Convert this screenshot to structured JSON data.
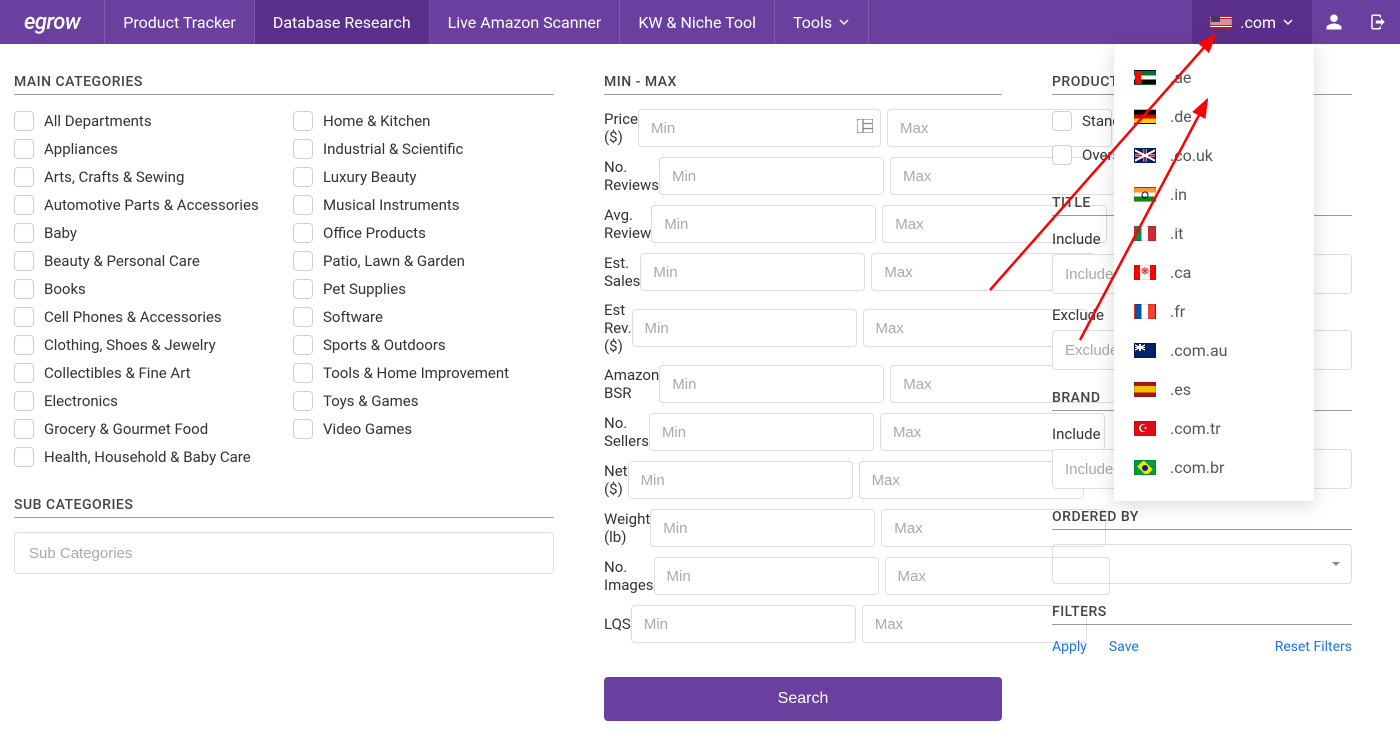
{
  "logo": "egrow",
  "nav": {
    "items": [
      {
        "label": "Product Tracker",
        "active": false
      },
      {
        "label": "Database Research",
        "active": true
      },
      {
        "label": "Live Amazon Scanner",
        "active": false
      },
      {
        "label": "KW & Niche Tool",
        "active": false
      },
      {
        "label": "Tools",
        "active": false,
        "hasChevron": true
      }
    ],
    "region_selected": ".com"
  },
  "region_options": [
    {
      "flag": "ae",
      "label": ".ae"
    },
    {
      "flag": "de",
      "label": ".de"
    },
    {
      "flag": "uk",
      "label": ".co.uk"
    },
    {
      "flag": "in",
      "label": ".in"
    },
    {
      "flag": "it",
      "label": ".it"
    },
    {
      "flag": "ca",
      "label": ".ca"
    },
    {
      "flag": "fr",
      "label": ".fr"
    },
    {
      "flag": "au",
      "label": ".com.au"
    },
    {
      "flag": "es",
      "label": ".es"
    },
    {
      "flag": "tr",
      "label": ".com.tr"
    },
    {
      "flag": "br",
      "label": ".com.br"
    }
  ],
  "main_categories": {
    "title": "MAIN CATEGORIES",
    "left": [
      "All Departments",
      "Appliances",
      "Arts, Crafts & Sewing",
      "Automotive Parts & Accessories",
      "Baby",
      "Beauty & Personal Care",
      "Books",
      "Cell Phones & Accessories",
      "Clothing, Shoes & Jewelry",
      "Collectibles & Fine Art",
      "Electronics",
      "Grocery & Gourmet Food",
      "Health, Household & Baby Care"
    ],
    "right": [
      "Home & Kitchen",
      "Industrial & Scientific",
      "Luxury Beauty",
      "Musical Instruments",
      "Office Products",
      "Patio, Lawn & Garden",
      "Pet Supplies",
      "Software",
      "Sports & Outdoors",
      "Tools & Home Improvement",
      "Toys & Games",
      "Video Games"
    ]
  },
  "sub_categories": {
    "title": "SUB CATEGORIES",
    "placeholder": "Sub Categories"
  },
  "minmax": {
    "title": "MIN - MAX",
    "min_placeholder": "Min",
    "max_placeholder": "Max",
    "rows": [
      "Price ($)",
      "No. Reviews",
      "Avg. Review",
      "Est. Sales",
      "Est Rev. ($)",
      "Amazon BSR",
      "No. Sellers",
      "Net ($)",
      "Weight (lb)",
      "No. Images",
      "LQS"
    ],
    "search_label": "Search"
  },
  "product_size": {
    "title": "PRODUCT SIZE",
    "options": [
      "Standard",
      "Oversized"
    ]
  },
  "title_filter": {
    "title": "TITLE",
    "include_label": "Include",
    "include_placeholder": "Included keywords",
    "exclude_label": "Exclude",
    "exclude_placeholder": "Excluded keywords"
  },
  "brand_filter": {
    "title": "BRAND",
    "include_label": "Include",
    "include_placeholder": "Include keywords"
  },
  "ordered_by": {
    "title": "ORDERED BY"
  },
  "filters": {
    "title": "FILTERS",
    "apply": "Apply",
    "save": "Save",
    "reset": "Reset Filters"
  }
}
